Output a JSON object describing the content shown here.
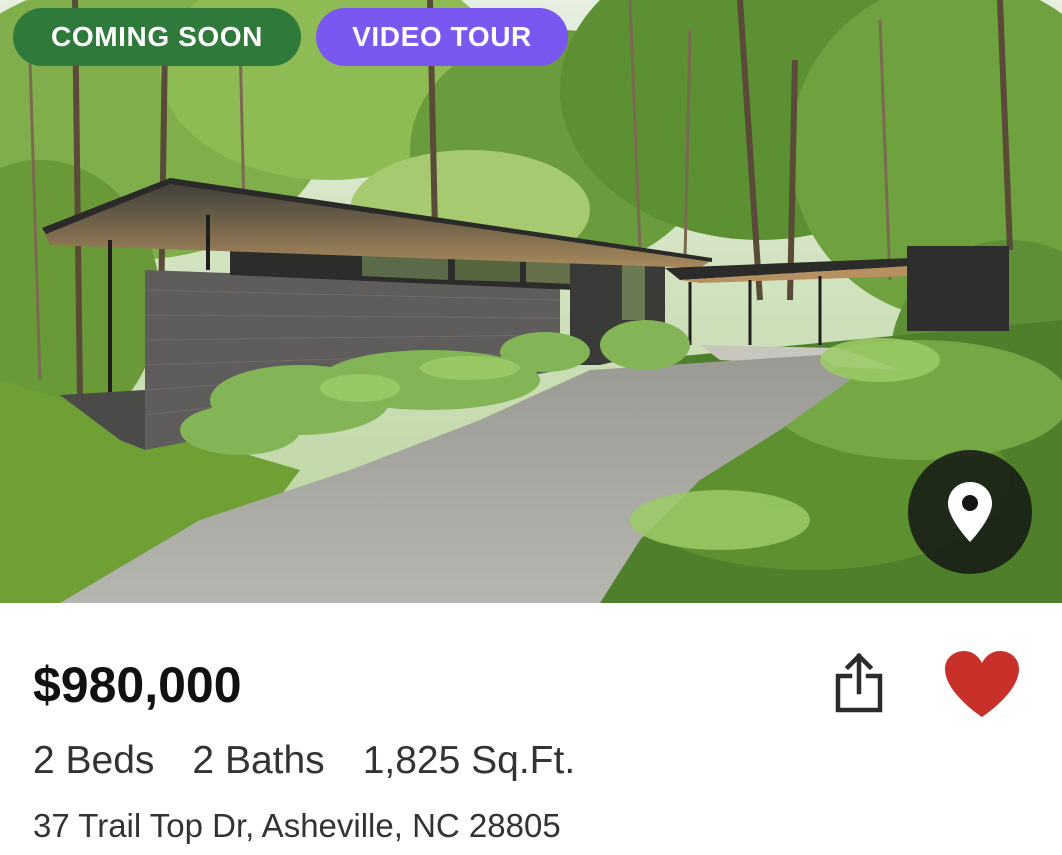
{
  "listing": {
    "badges": {
      "coming_soon": "COMING SOON",
      "video_tour": "VIDEO TOUR"
    },
    "price": "$980,000",
    "beds": "2 Beds",
    "baths": "2 Baths",
    "sqft": "1,825 Sq.Ft.",
    "address": "37 Trail Top Dr, Asheville, NC 28805",
    "favorited": true
  },
  "icons": {
    "map": "map-pin-icon",
    "share": "share-icon",
    "favorite": "heart-icon"
  },
  "colors": {
    "coming_soon_badge": "#2f7a3a",
    "video_tour_badge": "#7a57f0",
    "heart": "#c8302a",
    "map_button": "#141814"
  }
}
